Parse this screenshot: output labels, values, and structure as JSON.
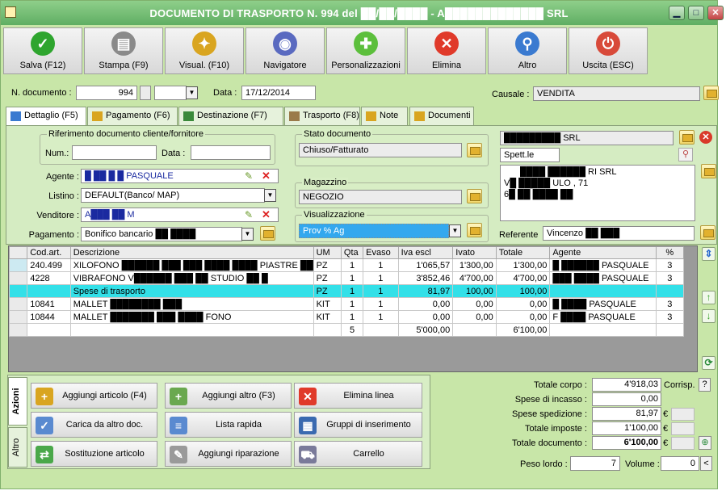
{
  "window": {
    "title": "DOCUMENTO DI TRASPORTO N. 994 del ██/██/████ - A█████████████ SRL",
    "minimize": "▁",
    "maximize": "□",
    "close": "✕"
  },
  "toolbar": [
    {
      "label": "Salva (F12)",
      "icon": "check-icon",
      "color": "#2ea52e",
      "glyph": "✓"
    },
    {
      "label": "Stampa (F9)",
      "icon": "printer-icon",
      "color": "#8a8a8a",
      "glyph": "▤"
    },
    {
      "label": "Visual. (F10)",
      "icon": "magic-wand-icon",
      "color": "#d9a520",
      "glyph": "✦"
    },
    {
      "label": "Navigatore",
      "icon": "compass-icon",
      "color": "#5a6ac0",
      "glyph": "◉"
    },
    {
      "label": "Personalizzazioni",
      "icon": "puzzle-icon",
      "color": "#5cbf3c",
      "glyph": "✚"
    },
    {
      "label": "Elimina",
      "icon": "delete-x-icon",
      "color": "#e03a2a",
      "glyph": "✕"
    },
    {
      "label": "Altro",
      "icon": "magnifier-icon",
      "color": "#3a7ad0",
      "glyph": "⚲"
    },
    {
      "label": "Uscita (ESC)",
      "icon": "power-icon",
      "color": "#d84a3a",
      "glyph": "⏻"
    }
  ],
  "header": {
    "ndoc_label": "N. documento :",
    "ndoc_value": "994",
    "ndoc_suffix": "",
    "data_label": "Data :",
    "data_value": "17/12/2014",
    "causale_label": "Causale :",
    "causale_value": "VENDITA"
  },
  "tabs": [
    {
      "label": "Dettaglio (F5)",
      "icon": "detail-icon"
    },
    {
      "label": "Pagamento (F6)",
      "icon": "payment-icon"
    },
    {
      "label": "Destinazione (F7)",
      "icon": "globe-icon"
    },
    {
      "label": "Trasporto (F8)",
      "icon": "truck-icon"
    },
    {
      "label": "Note",
      "icon": "note-icon"
    },
    {
      "label": "Documenti",
      "icon": "documents-icon"
    }
  ],
  "detail": {
    "rif_title": "Riferimento documento cliente/fornitore",
    "num_label": "Num.:",
    "num_value": "",
    "data_label": "Data :",
    "data_value": "",
    "agente_label": "Agente :",
    "agente_value": "█ ██ █ █ PASQUALE",
    "listino_label": "Listino :",
    "listino_value": "DEFAULT(Banco/ MAP)",
    "venditore_label": "Venditore :",
    "venditore_value": "A███ ██ M",
    "pagamento_label": "Pagamento :",
    "pagamento_value": "Bonifico bancario ██ ████",
    "stato_title": "Stato documento",
    "stato_value": "Chiuso/Fatturato",
    "magazzino_title": "Magazzino",
    "magazzino_value": "NEGOZIO",
    "visual_title": "Visualizzazione",
    "visual_value": "Prov % Ag",
    "cliente_name": "█████████ SRL",
    "spett": "Spett.le",
    "addr1": "████ ██████ RI SRL",
    "addr2": "V█ █████ ULO , 71",
    "addr3": "6█ ██ ████ ██",
    "referente_label": "Referente",
    "referente_value": "Vincenzo ██ ███"
  },
  "grid": {
    "columns": [
      "Cod.art.",
      "Descrizione",
      "UM",
      "Qta",
      "Evaso",
      "Iva escl",
      "Ivato",
      "Totale",
      "Agente",
      "%"
    ],
    "rows": [
      {
        "cod": "240.499",
        "desc": "XILOFONO ██████ ███ ███ ████ ████ PIASTRE ████ ███",
        "um": "PZ",
        "qta": "1",
        "evaso": "1",
        "iva_escl": "1'065,57",
        "ivato": "1'300,00",
        "totale": "1'300,00",
        "agente": "█ ██████ PASQUALE",
        "perc": "3"
      },
      {
        "cod": "4228",
        "desc": "VIBRAFONO V██████ ███ ██ STUDIO ██ █",
        "um": "PZ",
        "qta": "1",
        "evaso": "1",
        "iva_escl": "3'852,46",
        "ivato": "4'700,00",
        "totale": "4'700,00",
        "agente": "███ ████ PASQUALE",
        "perc": "3"
      },
      {
        "cod": "",
        "desc": "Spese di trasporto",
        "um": "PZ",
        "qta": "1",
        "evaso": "1",
        "iva_escl": "81,97",
        "ivato": "100,00",
        "totale": "100,00",
        "agente": "",
        "perc": ""
      },
      {
        "cod": "10841",
        "desc": "MALLET ████████ ███",
        "um": "KIT",
        "qta": "1",
        "evaso": "1",
        "iva_escl": "0,00",
        "ivato": "0,00",
        "totale": "0,00",
        "agente": "█ ████ PASQUALE",
        "perc": "3"
      },
      {
        "cod": "10844",
        "desc": "MALLET ███████ ███ ████ FONO",
        "um": "KIT",
        "qta": "1",
        "evaso": "1",
        "iva_escl": "0,00",
        "ivato": "0,00",
        "totale": "0,00",
        "agente": "F ████ PASQUALE",
        "perc": "3"
      }
    ],
    "footer": {
      "qta": "5",
      "iva_escl": "5'000,00",
      "totale": "6'100,00"
    }
  },
  "side_tabs": [
    "Azioni",
    "Altro"
  ],
  "actions": [
    {
      "label": "Aggiungi articolo (F4)",
      "icon": "add-article-icon",
      "color": "#d9a520",
      "glyph": "+"
    },
    {
      "label": "Aggiungi altro (F3)",
      "icon": "add-other-icon",
      "color": "#6aa84f",
      "glyph": "+"
    },
    {
      "label": "Elimina linea",
      "icon": "delete-line-icon",
      "color": "#e03a2a",
      "glyph": "✕"
    },
    {
      "label": "Carica da altro doc.",
      "icon": "load-doc-icon",
      "color": "#5a8ad0",
      "glyph": "✓"
    },
    {
      "label": "Lista rapida",
      "icon": "quick-list-icon",
      "color": "#5a8ad0",
      "glyph": "≡"
    },
    {
      "label": "Gruppi di inserimento",
      "icon": "groups-icon",
      "color": "#3a6ab0",
      "glyph": "▦"
    },
    {
      "label": "Sostituzione articolo",
      "icon": "replace-article-icon",
      "color": "#4aa84a",
      "glyph": "⇄"
    },
    {
      "label": "Aggiungi riparazione",
      "icon": "wrench-icon",
      "color": "#9a9a9a",
      "glyph": "✎"
    },
    {
      "label": "Carrello",
      "icon": "cart-icon",
      "color": "#7a7a9a",
      "glyph": "⛟"
    }
  ],
  "totals": {
    "corpo_label": "Totale corpo :",
    "corpo_value": "4'918,03",
    "corrisp_label": "Corrisp.",
    "corrisp_q": "?",
    "incasso_label": "Spese di incasso :",
    "incasso_value": "0,00",
    "spedizione_label": "Spese spedizione :",
    "spedizione_value": "81,97",
    "imposte_label": "Totale imposte :",
    "imposte_value": "1'100,00",
    "documento_label": "Totale documento :",
    "documento_value": "6'100,00",
    "currency": "€",
    "peso_label": "Peso lordo :",
    "peso_value": "7",
    "volume_label": "Volume :",
    "volume_value": "0",
    "volume_btn": "<"
  }
}
